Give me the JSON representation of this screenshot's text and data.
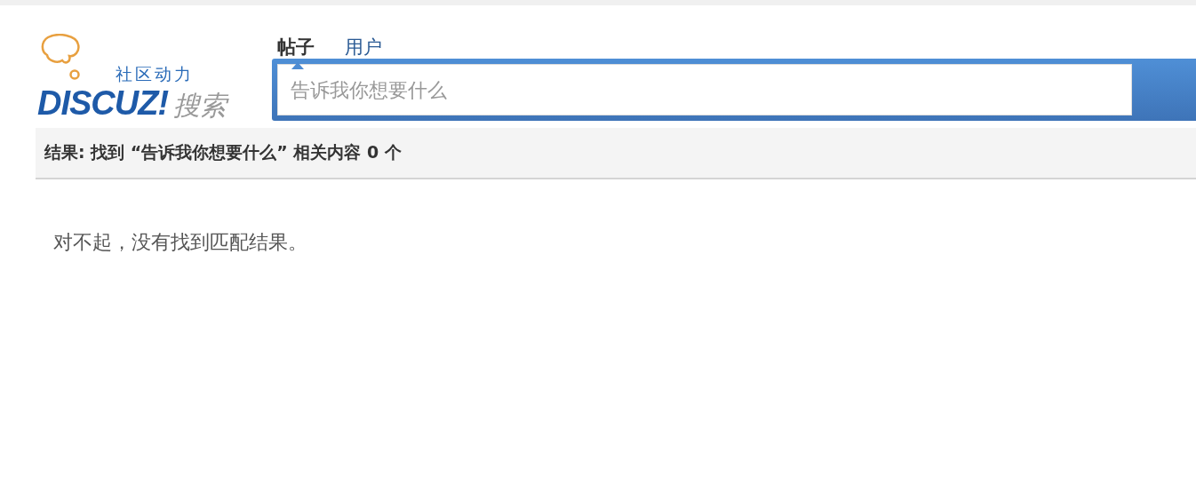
{
  "logo": {
    "tagline": "社区动力",
    "wordmark": "DISCUZ!",
    "suffix": "搜索"
  },
  "tabs": [
    {
      "label": "帖子",
      "selected": true
    },
    {
      "label": "用户",
      "selected": false
    }
  ],
  "search": {
    "placeholder": "告诉我你想要什么"
  },
  "result_bar": {
    "text": "结果: 找到 “告诉我你想要什么” 相关内容 0 个"
  },
  "message": "对不起，没有找到匹配结果。"
}
